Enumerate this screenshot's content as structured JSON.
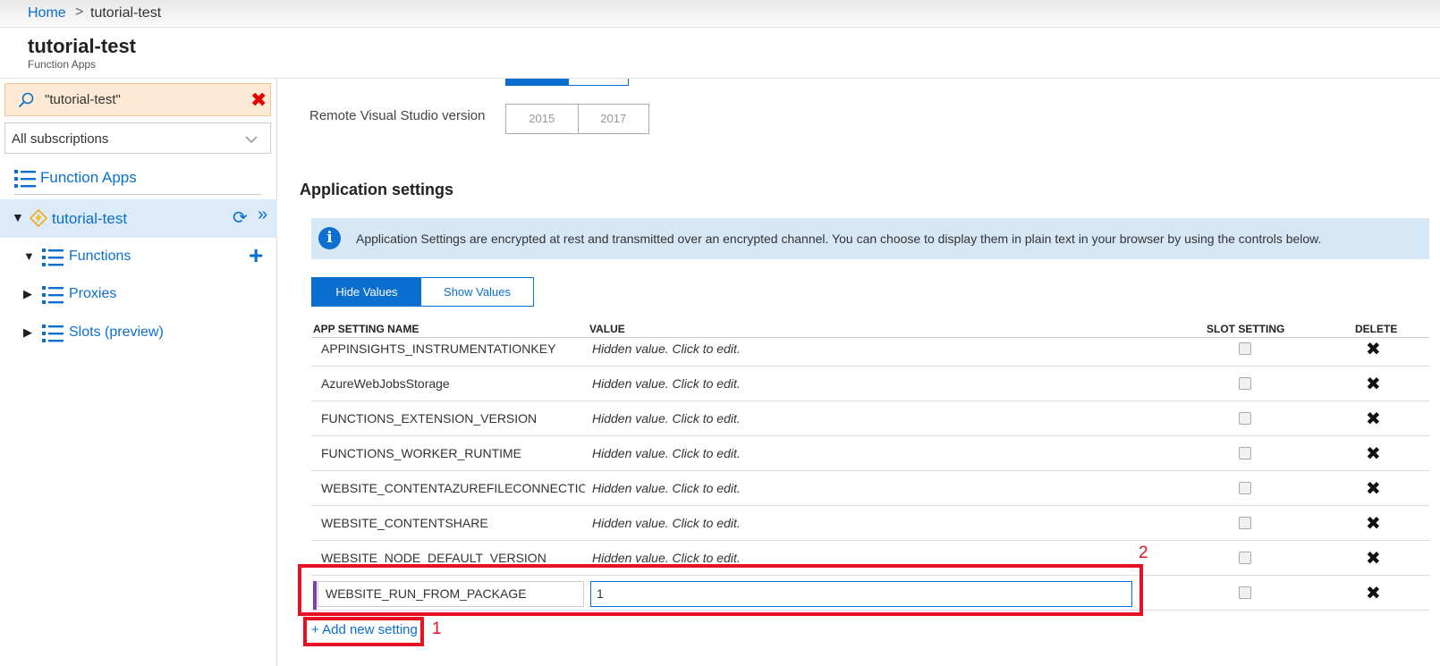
{
  "breadcrumb": {
    "home": "Home",
    "separator": ">",
    "current": "tutorial-test"
  },
  "header": {
    "title": "tutorial-test",
    "subtitle": "Function Apps"
  },
  "sidebar": {
    "search_text": "\"tutorial-test\"",
    "subscription": "All subscriptions",
    "function_apps_label": "Function Apps",
    "app_name": "tutorial-test",
    "items": [
      {
        "label": "Functions",
        "expanded": true
      },
      {
        "label": "Proxies",
        "expanded": false
      },
      {
        "label": "Slots (preview)",
        "expanded": false
      }
    ]
  },
  "main": {
    "remote_vs_label": "Remote Visual Studio version",
    "vs_versions": [
      "2015",
      "2017"
    ],
    "section_title": "Application settings",
    "info_text": "Application Settings are encrypted at rest and transmitted over an encrypted channel. You can choose to display them in plain text in your browser by using the controls below.",
    "hide_values": "Hide Values",
    "show_values": "Show Values",
    "columns": {
      "name": "APP SETTING NAME",
      "value": "VALUE",
      "slot": "SLOT SETTING",
      "delete": "DELETE"
    },
    "rows": [
      {
        "name": "APPINSIGHTS_INSTRUMENTATIONKEY",
        "value": "Hidden value. Click to edit."
      },
      {
        "name": "AzureWebJobsStorage",
        "value": "Hidden value. Click to edit."
      },
      {
        "name": "FUNCTIONS_EXTENSION_VERSION",
        "value": "Hidden value. Click to edit."
      },
      {
        "name": "FUNCTIONS_WORKER_RUNTIME",
        "value": "Hidden value. Click to edit."
      },
      {
        "name": "WEBSITE_CONTENTAZUREFILECONNECTIO...",
        "value": "Hidden value. Click to edit."
      },
      {
        "name": "WEBSITE_CONTENTSHARE",
        "value": "Hidden value. Click to edit."
      },
      {
        "name": "WEBSITE_NODE_DEFAULT_VERSION",
        "value": "Hidden value. Click to edit."
      }
    ],
    "new_row": {
      "name": "WEBSITE_RUN_FROM_PACKAGE",
      "value": "1"
    },
    "add_setting": "+ Add new setting",
    "annotations": {
      "one": "1",
      "two": "2"
    }
  },
  "colors": {
    "accent": "#0b6fcf",
    "highlight": "#e81123",
    "search_bg": "#fde9d4",
    "info_bg": "#d6e8f6"
  }
}
